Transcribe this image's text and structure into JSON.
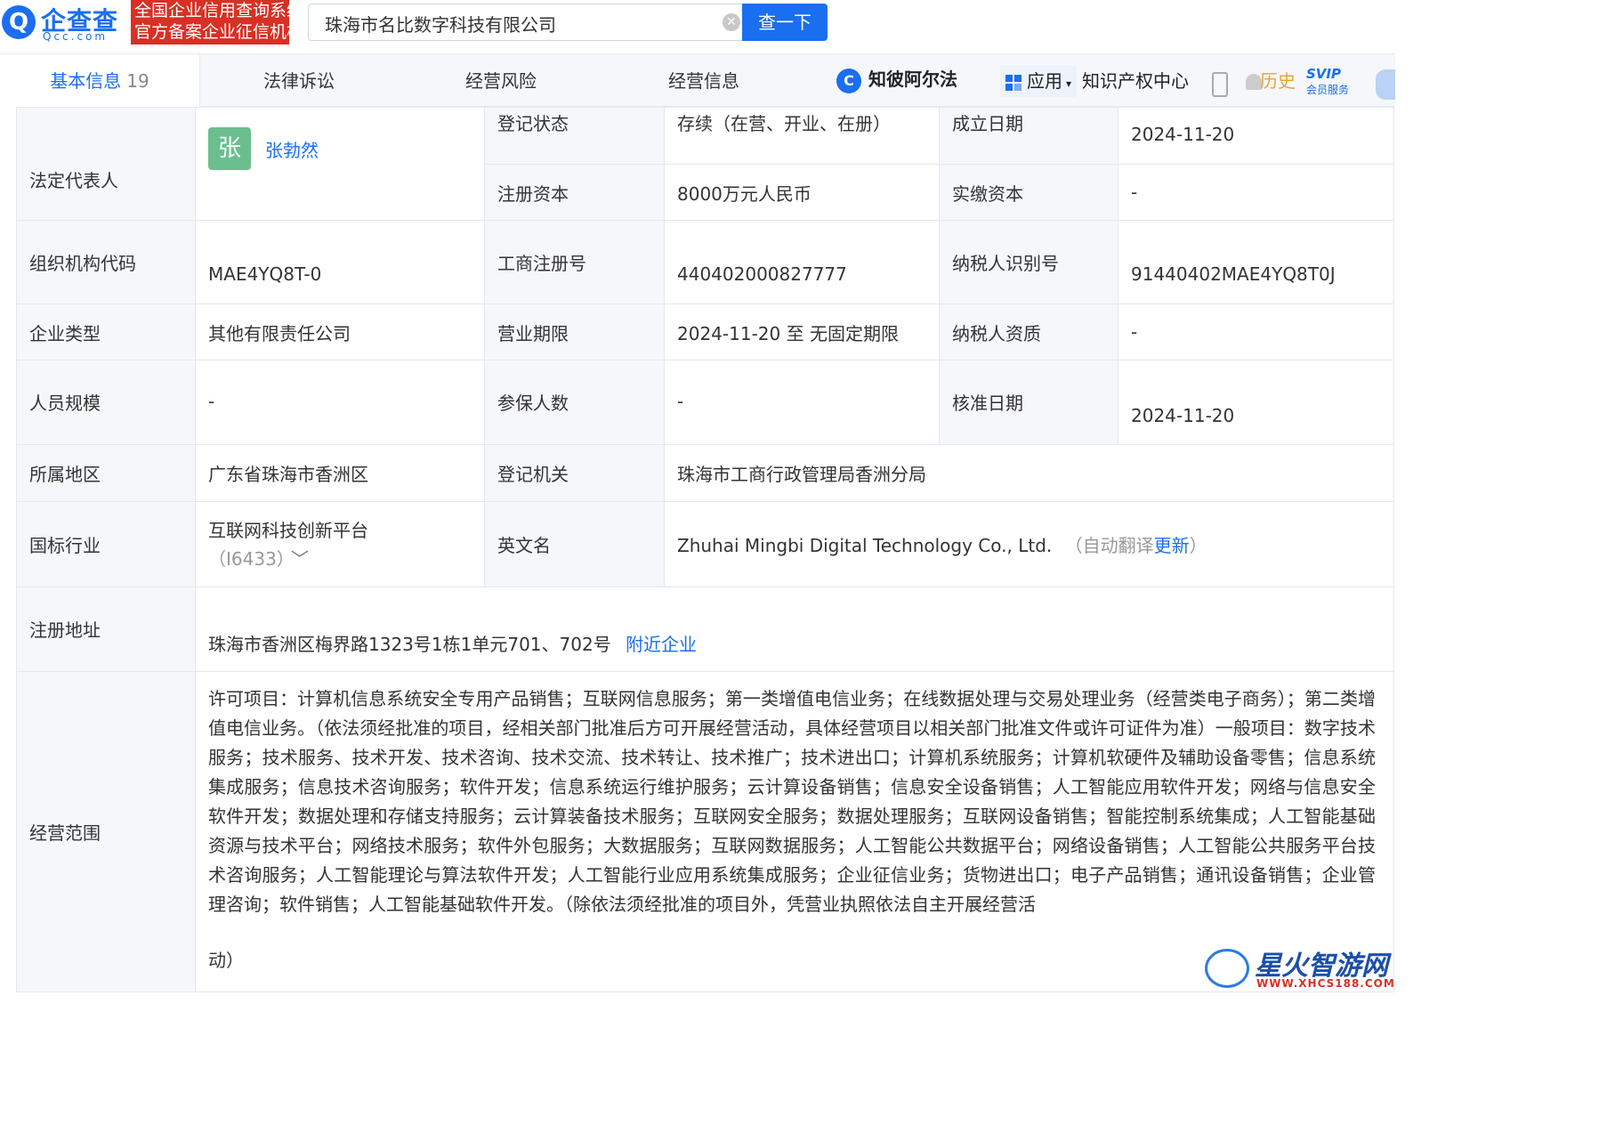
{
  "header": {
    "logo_mark": "Q",
    "logo_text": "企查查",
    "logo_sub": "Qcc.com",
    "banner_line1": "全国企业信用查询系统",
    "banner_line2": "官方备案企业征信机构",
    "search_value": "珠海市名比数字科技有限公司",
    "search_button": "查一下"
  },
  "nav": {
    "tabs": [
      {
        "label": "基本信息",
        "count": "19"
      },
      {
        "label": "法律诉讼"
      },
      {
        "label": "经营风险"
      },
      {
        "label": "经营信息"
      }
    ],
    "zhibi_label": "知彼阿尔法",
    "apps_label": "应用",
    "ip_center": "知识产权中心",
    "history": "历史",
    "svip_top": "SVIP",
    "svip_bottom": "会员服务"
  },
  "info": {
    "legal_rep_label": "法定代表人",
    "legal_rep_badge": "张",
    "legal_rep_name": "张勃然",
    "reg_status_label": "登记状态",
    "reg_status_value": "存续（在营、开业、在册）",
    "found_date_label": "成立日期",
    "found_date_value": "2024-11-20",
    "reg_capital_label": "注册资本",
    "reg_capital_value": "8000万元人民币",
    "paid_capital_label": "实缴资本",
    "paid_capital_value": "-",
    "org_code_label": "组织机构代码",
    "org_code_value": "MAE4YQ8T-0",
    "biz_reg_no_label": "工商注册号",
    "biz_reg_no_value": "440402000827777",
    "taxpayer_id_label": "纳税人识别号",
    "taxpayer_id_value": "91440402MAE4YQ8T0J",
    "company_type_label": "企业类型",
    "company_type_value": "其他有限责任公司",
    "biz_term_label": "营业期限",
    "biz_term_value": "2024-11-20 至 无固定期限",
    "taxpayer_qual_label": "纳税人资质",
    "taxpayer_qual_value": "-",
    "staff_size_label": "人员规模",
    "staff_size_value": "-",
    "insured_label": "参保人数",
    "insured_value": "-",
    "approval_date_label": "核准日期",
    "approval_date_value": "2024-11-20",
    "region_label": "所属地区",
    "region_value": "广东省珠海市香洲区",
    "reg_authority_label": "登记机关",
    "reg_authority_value": "珠海市工商行政管理局香洲分局",
    "industry_label": "国标行业",
    "industry_value": "互联网科技创新平台",
    "industry_code": "（I6433）",
    "english_name_label": "英文名",
    "english_name_value": "Zhuhai Mingbi Digital Technology Co., Ltd.",
    "auto_translate_prefix": "（自动翻译",
    "auto_translate_update": "更新",
    "auto_translate_suffix": "）",
    "address_label": "注册地址",
    "address_value": "珠海市香洲区梅界路1323号1栋1单元701、702号",
    "nearby_link": "附近企业",
    "scope_label": "经营范围",
    "scope_value": "许可项目：计算机信息系统安全专用产品销售；互联网信息服务；第一类增值电信业务；在线数据处理与交易处理业务（经营类电子商务）；第二类增值电信业务。（依法须经批准的项目，经相关部门批准后方可开展经营活动，具体经营项目以相关部门批准文件或许可证件为准）一般项目：数字技术服务；技术服务、技术开发、技术咨询、技术交流、技术转让、技术推广；技术进出口；计算机系统服务；计算机软硬件及辅助设备零售；信息系统集成服务；信息技术咨询服务；软件开发；信息系统运行维护服务；云计算设备销售；信息安全设备销售；人工智能应用软件开发；网络与信息安全软件开发；数据处理和存储支持服务；云计算装备技术服务；互联网安全服务；数据处理服务；互联网设备销售；智能控制系统集成；人工智能基础资源与技术平台；网络技术服务；软件外包服务；大数据服务；互联网数据服务；人工智能公共数据平台；网络设备销售；人工智能公共服务平台技术咨询服务；人工智能理论与算法软件开发；人工智能行业应用系统集成服务；企业征信业务；货物进出口；电子产品销售；通讯设备销售；企业管理咨询；软件销售；人工智能基础软件开发。（除依法须经批准的项目外，凭营业执照依法自主开展经营活",
    "scope_tail": "动）"
  },
  "watermark": {
    "title": "星火智游网",
    "url": "WWW.XHCS188.COM"
  }
}
